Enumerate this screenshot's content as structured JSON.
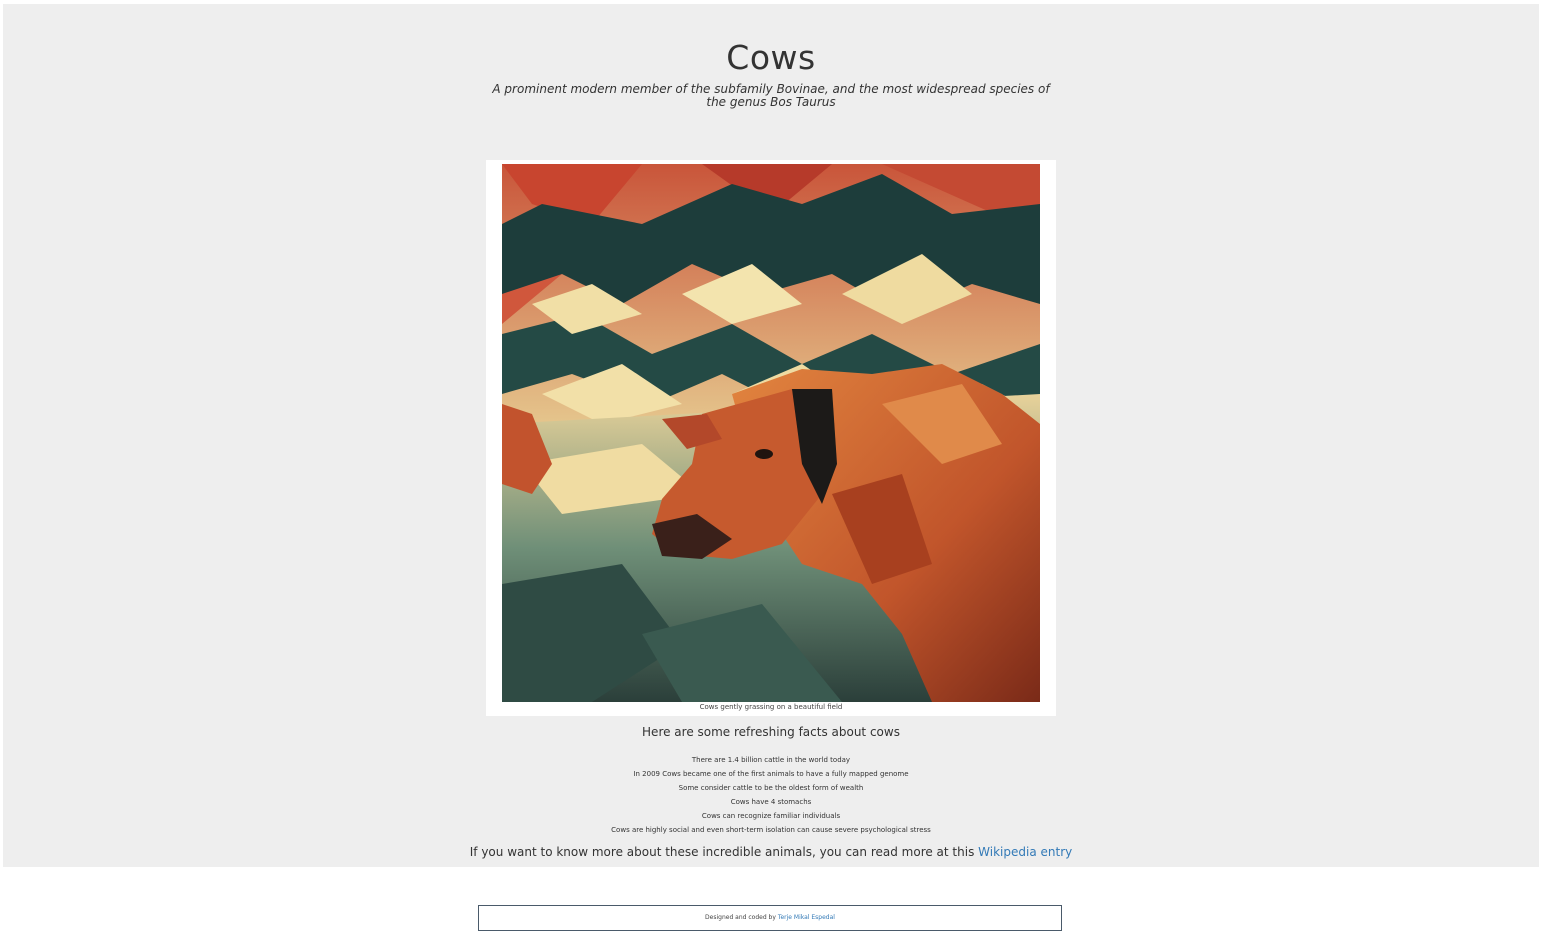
{
  "page": {
    "title": "Cows",
    "subtitle": "A prominent modern member of the subfamily Bovinae, and the most widespread species of the genus Bos Taurus"
  },
  "figure": {
    "image_subject": "stylized painting of a brown cow in a field",
    "caption": "Cows gently grassing on a beautiful field"
  },
  "facts": {
    "heading": "Here are some refreshing facts about cows",
    "items": [
      "There are 1.4 billion cattle in the world today",
      "In 2009 Cows became one of the first animals to have a fully mapped genome",
      "Some consider cattle to be the oldest form of wealth",
      "Cows have 4 stomachs",
      "Cows can recognize familiar individuals",
      "Cows are highly social and even short-term isolation can cause severe psychological stress"
    ]
  },
  "more": {
    "text": "If you want to know more about these incredible animals, you can read more at this ",
    "link_label": "Wikipedia entry"
  },
  "footer": {
    "text": "Designed and coded by ",
    "author_link": "Terje Mikal Espedal"
  },
  "colors": {
    "page_background": "#eeeeee",
    "link": "#337ab7",
    "text": "#333333"
  }
}
